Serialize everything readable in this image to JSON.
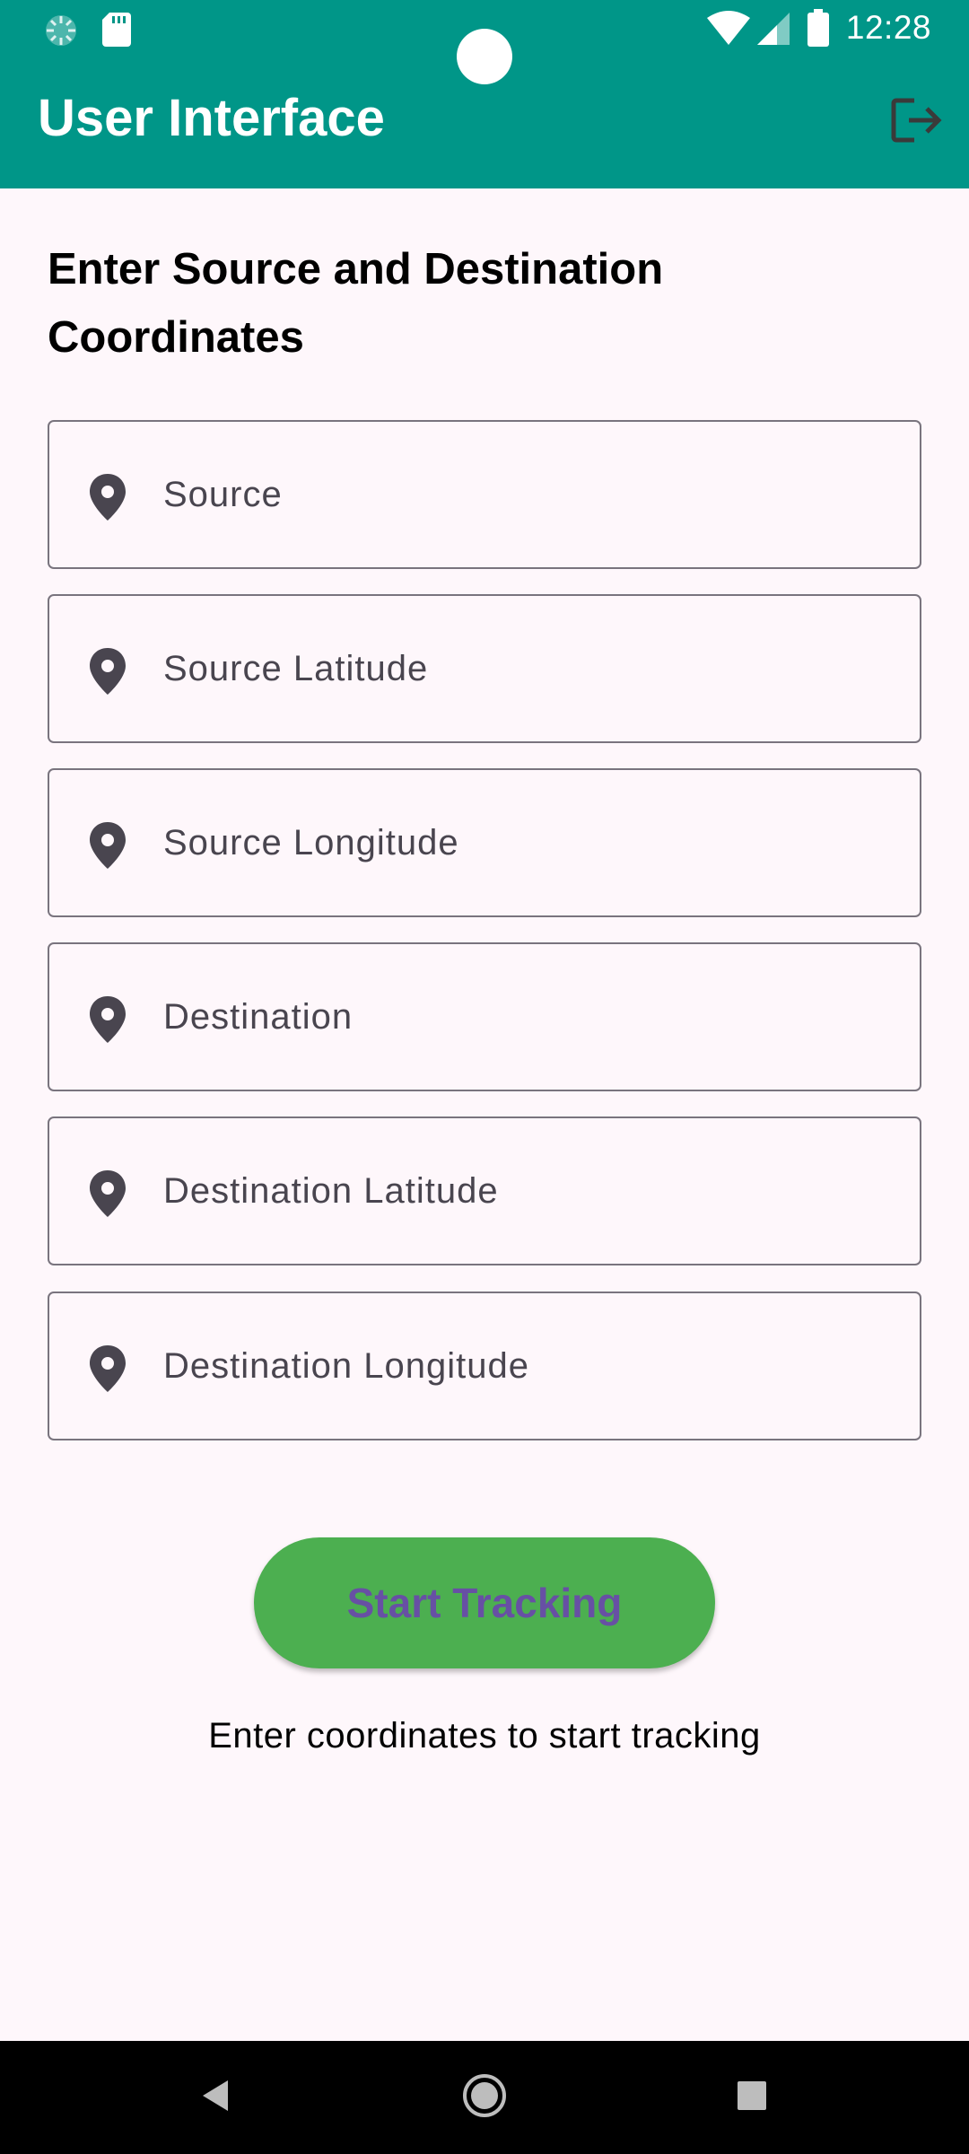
{
  "status_bar": {
    "time": "12:28",
    "icons": [
      "spinner-icon",
      "sd-card-icon",
      "wifi-icon",
      "cellular-signal-icon",
      "battery-icon"
    ]
  },
  "app_bar": {
    "title": "User Interface",
    "logout_icon": "logout-icon",
    "background_color": "#009688"
  },
  "form": {
    "heading": "Enter Source and Destination Coordinates",
    "fields": [
      {
        "placeholder": "Source",
        "icon": "location-pin-icon"
      },
      {
        "placeholder": "Source Latitude",
        "icon": "location-pin-icon"
      },
      {
        "placeholder": "Source Longitude",
        "icon": "location-pin-icon"
      },
      {
        "placeholder": "Destination",
        "icon": "location-pin-icon"
      },
      {
        "placeholder": "Destination Latitude",
        "icon": "location-pin-icon"
      },
      {
        "placeholder": "Destination Longitude",
        "icon": "location-pin-icon"
      }
    ],
    "start_button_label": "Start Tracking",
    "start_button_color": "#4caf50",
    "start_button_text_color": "#6750a4",
    "status_message": "Enter coordinates to start tracking"
  },
  "nav_bar": {
    "buttons": [
      "back-icon",
      "home-icon",
      "recents-icon"
    ]
  }
}
